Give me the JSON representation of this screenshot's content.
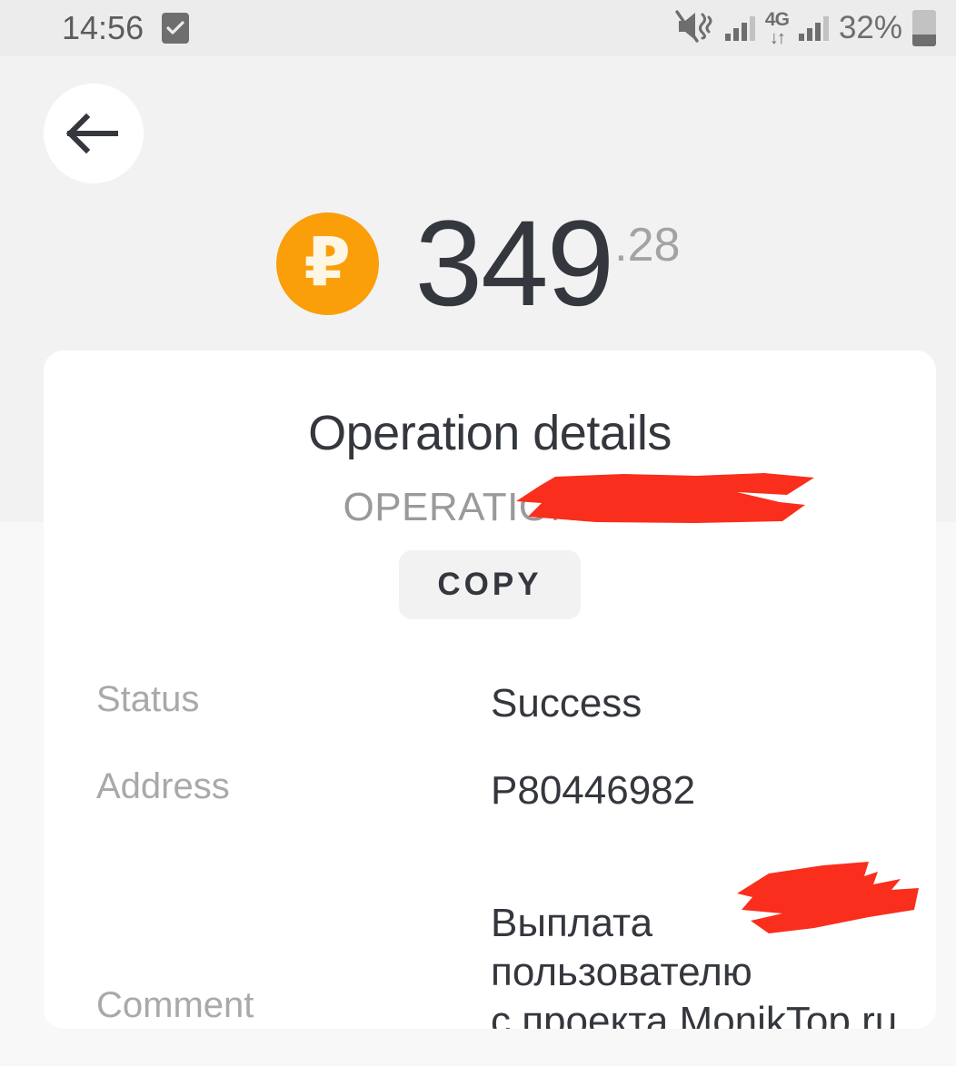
{
  "status_bar": {
    "time": "14:56",
    "checkbox_icon": "checkbox-checked-icon",
    "mute_icon": "mute-vibrate-icon",
    "signal_icon_1": "signal-bars-icon",
    "network_type": "4G",
    "network_arrows": "↓↑",
    "signal_icon_2": "signal-bars-icon",
    "battery_percent": "32%",
    "battery_icon": "battery-icon"
  },
  "nav": {
    "back_icon": "arrow-left-icon"
  },
  "balance": {
    "currency_icon": "ruble-coin-icon",
    "currency_glyph": "₽",
    "integer": "349",
    "fraction": ".28",
    "coin_color": "#FA9E0A",
    "glyph_color": "#FDF6E4"
  },
  "card": {
    "title": "Operation details",
    "operation_id": "OPERATION #1",
    "copy_label": "COPY",
    "rows": [
      {
        "label": "Status",
        "value": "Success"
      },
      {
        "label": "Address",
        "value": "P80446982"
      },
      {
        "label": "Comment",
        "value": "Выплата\nпользователю\nс проекта MonikTop.ru"
      }
    ]
  },
  "redactions": {
    "color": "#F92E1C",
    "operation_mark": "redaction-mark",
    "comment_mark": "redaction-mark"
  }
}
